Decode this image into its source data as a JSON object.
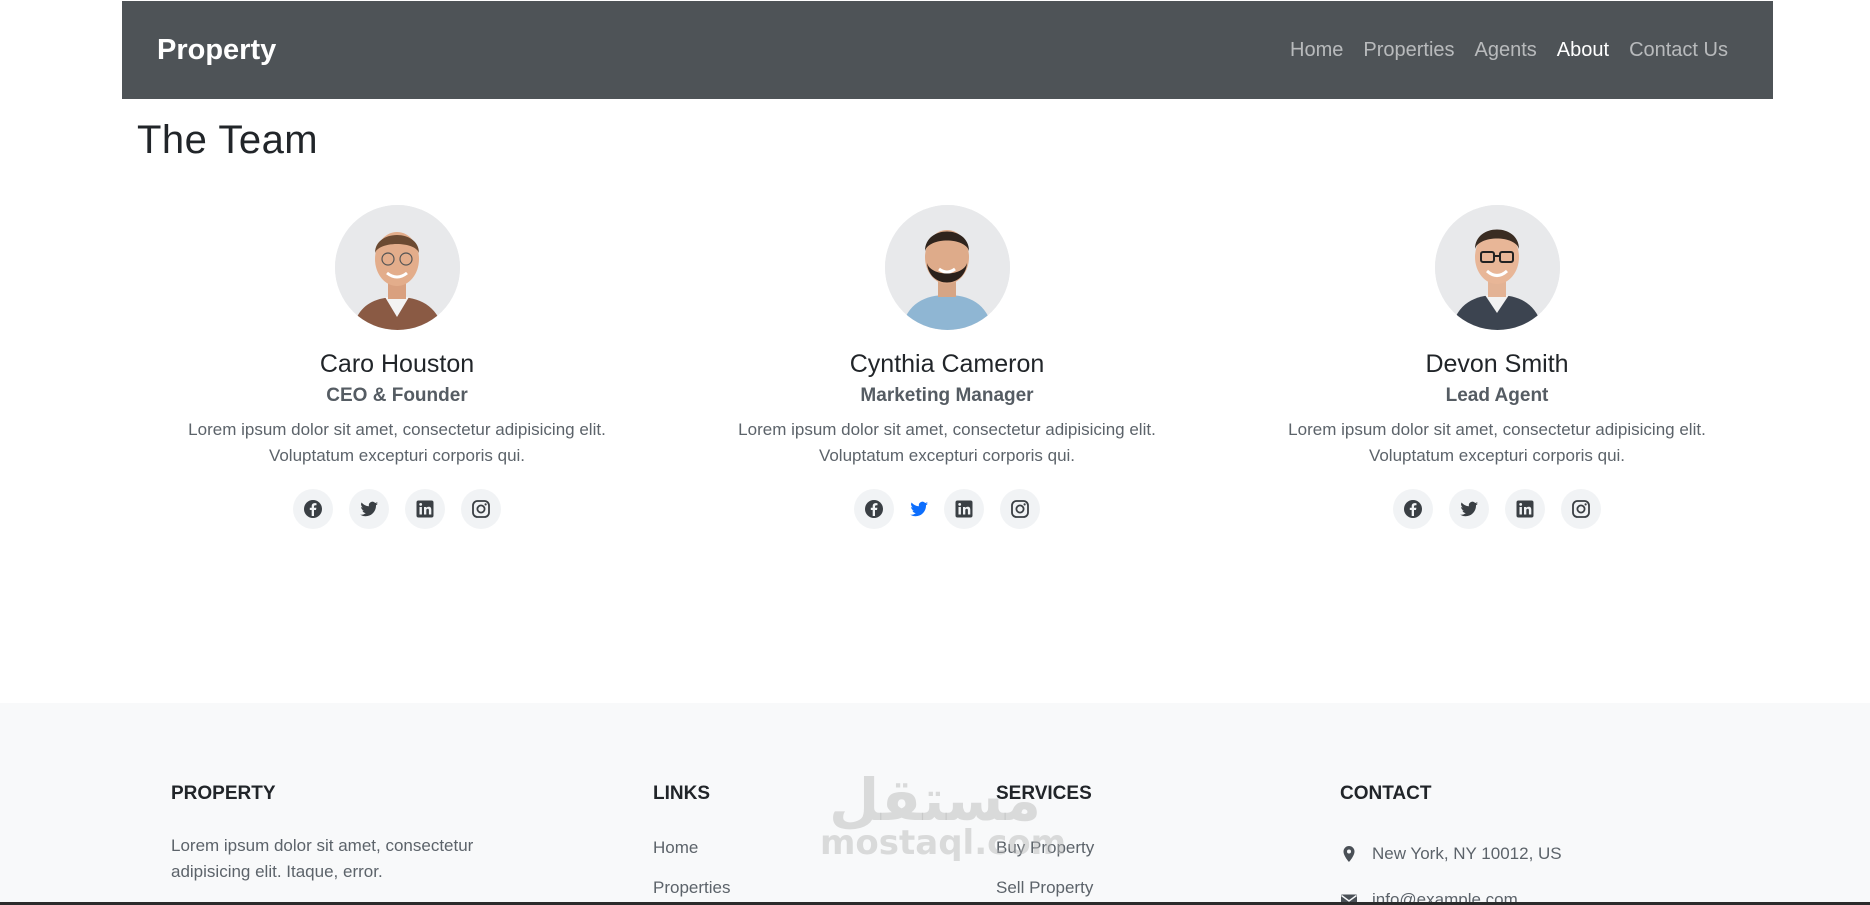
{
  "navbar": {
    "brand": "Property",
    "links": [
      {
        "label": "Home"
      },
      {
        "label": "Properties"
      },
      {
        "label": "Agents"
      },
      {
        "label": "About"
      },
      {
        "label": "Contact Us"
      }
    ]
  },
  "page": {
    "title": "The Team"
  },
  "team": [
    {
      "name": "Caro Houston",
      "role": "CEO & Founder",
      "bio": "Lorem ipsum dolor sit amet, consectetur adipisicing elit. Voluptatum excepturi corporis qui."
    },
    {
      "name": "Cynthia Cameron",
      "role": "Marketing Manager",
      "bio": "Lorem ipsum dolor sit amet, consectetur adipisicing elit. Voluptatum excepturi corporis qui."
    },
    {
      "name": "Devon Smith",
      "role": "Lead Agent",
      "bio": "Lorem ipsum dolor sit amet, consectetur adipisicing elit. Voluptatum excepturi corporis qui."
    }
  ],
  "socials": [
    "facebook-icon",
    "twitter-icon",
    "linkedin-icon",
    "instagram-icon"
  ],
  "footer": {
    "property": {
      "title": "PROPERTY",
      "text": "Lorem ipsum dolor sit amet, consectetur adipisicing elit. Itaque, error."
    },
    "links": {
      "title": "LINKS",
      "items": [
        "Home",
        "Properties"
      ]
    },
    "services": {
      "title": "SERVICES",
      "items": [
        "Buy Property",
        "Sell Property"
      ]
    },
    "contact": {
      "title": "CONTACT",
      "address": "New York, NY 10012, US",
      "email": "info@example.com"
    }
  },
  "watermark": {
    "arabic": "مستقل",
    "latin": "mostaql.com"
  },
  "colors": {
    "navbar": "#4e5357",
    "twitter_active": "#0d6efd",
    "footer_bg": "#f8f9fa"
  }
}
